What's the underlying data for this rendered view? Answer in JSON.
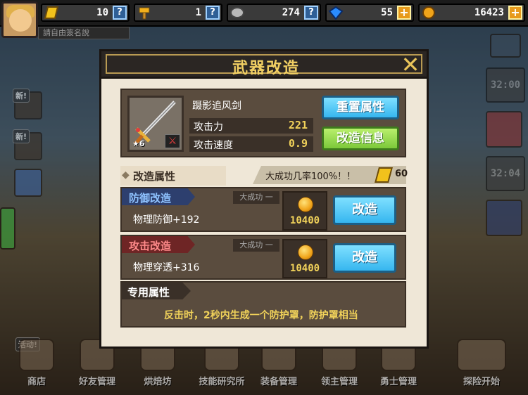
{
  "topbar": {
    "sign_placeholder": "請自由簽名說",
    "resources": [
      {
        "icon": "gold-ticket-icon",
        "value": "10",
        "action": "?"
      },
      {
        "icon": "hammer-icon",
        "value": "1",
        "action": "?"
      },
      {
        "icon": "whetstone-icon",
        "value": "274",
        "action": "?"
      },
      {
        "icon": "diamond-icon",
        "value": "55",
        "action": "+"
      },
      {
        "icon": "gold-coin-icon",
        "value": "16423",
        "action": "+"
      }
    ]
  },
  "side": {
    "new_badge": "新!",
    "timers": [
      "32:00",
      "32:04"
    ]
  },
  "dialog": {
    "title": "武器改造",
    "close": "✕",
    "item": {
      "name": "蹑影追风剑",
      "level": "★6",
      "stats": [
        {
          "label": "攻击力",
          "value": "221"
        },
        {
          "label": "攻击速度",
          "value": "0.9"
        }
      ],
      "reset_button": "重置属性",
      "reform_info_button": "改造信息"
    },
    "reform_section": {
      "title": "改造属性",
      "chance_text": "大成功几率100%！！",
      "ticket_count": "60"
    },
    "reforms": [
      {
        "tag": "防御改造",
        "great": "大成功 一",
        "desc": "物理防御+192",
        "cost": "10400",
        "button": "改造"
      },
      {
        "tag": "攻击改造",
        "great": "大成功 一",
        "desc": "物理穿透+316",
        "cost": "10400",
        "button": "改造"
      }
    ],
    "exclusive": {
      "title": "专用属性",
      "desc": "反击时，2秒内生成一个防护罩，防护罩相当"
    }
  },
  "dock": {
    "event_badge": "活动!",
    "items": [
      "商店",
      "好友管理",
      "烘焙坊",
      "技能研究所",
      "装备管理",
      "领主管理",
      "勇士管理",
      "探险开始"
    ]
  },
  "colors": {
    "title_gold": "#f1cf63",
    "button_blue": "#36b6ef",
    "button_green": "#7cc93a",
    "value_yellow": "#f1d25a"
  }
}
